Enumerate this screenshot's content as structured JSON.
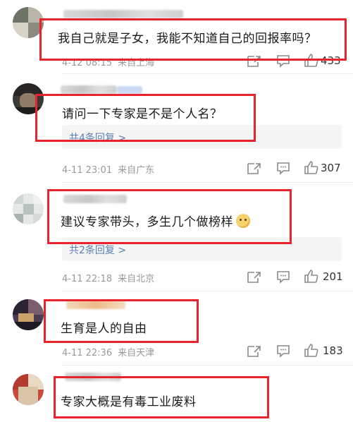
{
  "comments": [
    {
      "text": "我自己就是子女，我能不知道自己的回报率吗？",
      "date": "4-12 08:15",
      "location": "来自上海",
      "likes": "433"
    },
    {
      "text": "请问一下专家是不是个人名？",
      "replies": "共4条回复 >",
      "date": "4-11 23:01",
      "location": "来自广东",
      "likes": "307"
    },
    {
      "text": "建议专家带头，多生几个做榜样",
      "replies": "共2条回复 >",
      "date": "4-11 22:18",
      "location": "来自北京",
      "likes": "201"
    },
    {
      "text": "生育是人的自由",
      "date": "4-11 22:36",
      "location": "来自天津",
      "likes": "183"
    },
    {
      "text": "专家大概是有毒工业废料"
    }
  ],
  "icons": {
    "share": "share-icon",
    "reply": "comment-icon",
    "like": "thumbs-up-icon",
    "emoji": "doge-emoji-icon"
  },
  "colors": {
    "highlight": "#e8232d",
    "reply_link": "#5b7fb5",
    "meta": "#9a9a9a"
  }
}
